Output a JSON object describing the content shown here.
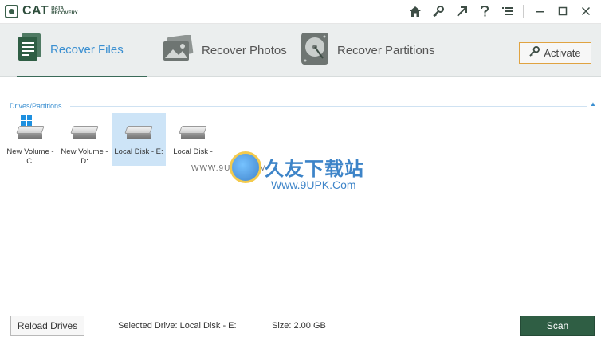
{
  "app": {
    "logo_text": "CAT",
    "logo_sub_line1": "DATA",
    "logo_sub_line2": "RECOVERY"
  },
  "titlebar_icons": [
    "home-icon",
    "key-icon",
    "upgrade-arrow-icon",
    "help-icon",
    "menu-icon",
    "minimize-icon",
    "maximize-icon",
    "close-icon"
  ],
  "tabs": [
    {
      "label": "Recover Files",
      "active": true,
      "icon": "files-icon"
    },
    {
      "label": "Recover Photos",
      "active": false,
      "icon": "photos-icon"
    },
    {
      "label": "Recover Partitions",
      "active": false,
      "icon": "hard-disk-icon"
    }
  ],
  "activate_label": "Activate",
  "section_label": "Drives/Partitions",
  "drives": [
    {
      "line1": "New Volume -",
      "line2": "C:",
      "system": true,
      "selected": false
    },
    {
      "line1": "New Volume -",
      "line2": "D:",
      "system": false,
      "selected": false
    },
    {
      "line1": "Local Disk - E:",
      "line2": "",
      "system": false,
      "selected": true
    },
    {
      "line1": "Local Disk -",
      "line2": "",
      "system": false,
      "selected": false
    }
  ],
  "watermark": {
    "text_cn": "久友下载站",
    "text_url": "Www.9UPK.Com",
    "text_left": "WWW.9UPK.COM"
  },
  "bottom": {
    "reload_label": "Reload Drives",
    "selected_drive_text": "Selected Drive: Local Disk - E:",
    "size_text": "Size: 2.00 GB",
    "scan_label": "Scan"
  },
  "colors": {
    "accent_green": "#2f5e44",
    "accent_blue": "#3a8fd1",
    "activate_border": "#e0a341",
    "selection": "#cde4f7"
  }
}
